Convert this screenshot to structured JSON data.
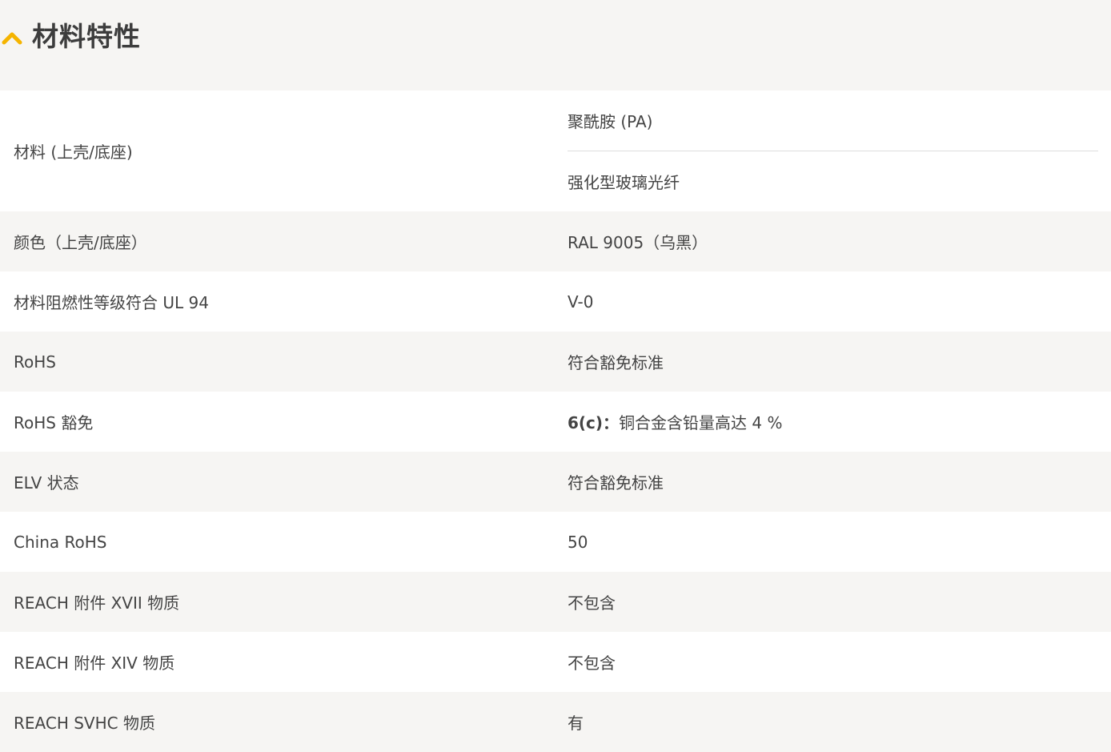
{
  "section": {
    "title": "材料特性",
    "icon": "chevron-up-icon",
    "accent_color": "#f5b400"
  },
  "rows": [
    {
      "label": "材料 (上壳/底座)",
      "values": [
        "聚酰胺 (PA)",
        "强化型玻璃光纤"
      ]
    },
    {
      "label": "颜色（上壳/底座）",
      "value": "RAL 9005（乌黑）"
    },
    {
      "label": "材料阻燃性等级符合 UL 94",
      "value": "V-0"
    },
    {
      "label": "RoHS",
      "value": "符合豁免标准"
    },
    {
      "label": "RoHS 豁免",
      "value_bold": "6(c)：",
      "value": "铜合金含铅量高达 4 %"
    },
    {
      "label": "ELV 状态",
      "value": "符合豁免标准"
    },
    {
      "label": "China RoHS",
      "value": "50"
    },
    {
      "label": "REACH 附件 XVII 物质",
      "value": "不包含"
    },
    {
      "label": "REACH 附件 XIV 物质",
      "value": "不包含"
    },
    {
      "label": "REACH SVHC 物质",
      "value": "有"
    }
  ]
}
